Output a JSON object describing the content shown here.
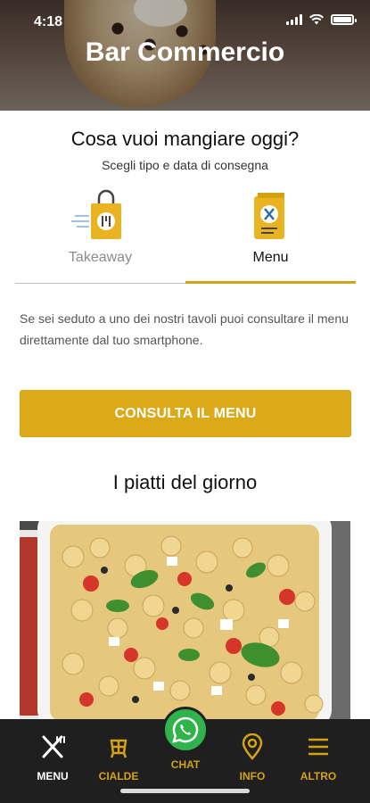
{
  "status_bar": {
    "time": "4:18"
  },
  "header": {
    "title": "Bar Commercio"
  },
  "intro": {
    "question": "Cosa vuoi mangiare oggi?",
    "subtitle": "Scegli tipo e data di consegna"
  },
  "tabs": [
    {
      "label": "Takeaway",
      "icon": "shopping-bag-icon",
      "active": false
    },
    {
      "label": "Menu",
      "icon": "menu-card-icon",
      "active": true
    }
  ],
  "content": {
    "description": "Se sei seduto a uno dei nostri tavoli puoi consultare il menu direttamente dal tuo smartphone.",
    "cta_label": "CONSULTA IL MENU",
    "section_title": "I piatti del giorno"
  },
  "bottom_nav": [
    {
      "label": "MENU",
      "icon": "fork-knife-icon",
      "active": true
    },
    {
      "label": "CIALDE",
      "icon": "cialde-icon",
      "active": false
    },
    {
      "label": "CHAT",
      "icon": "whatsapp-icon",
      "active": false
    },
    {
      "label": "INFO",
      "icon": "location-pin-icon",
      "active": false
    },
    {
      "label": "ALTRO",
      "icon": "hamburger-icon",
      "active": false
    }
  ],
  "colors": {
    "accent": "#dca919",
    "nav_background": "#1f1f1f",
    "chat_green": "#2fb34a"
  }
}
